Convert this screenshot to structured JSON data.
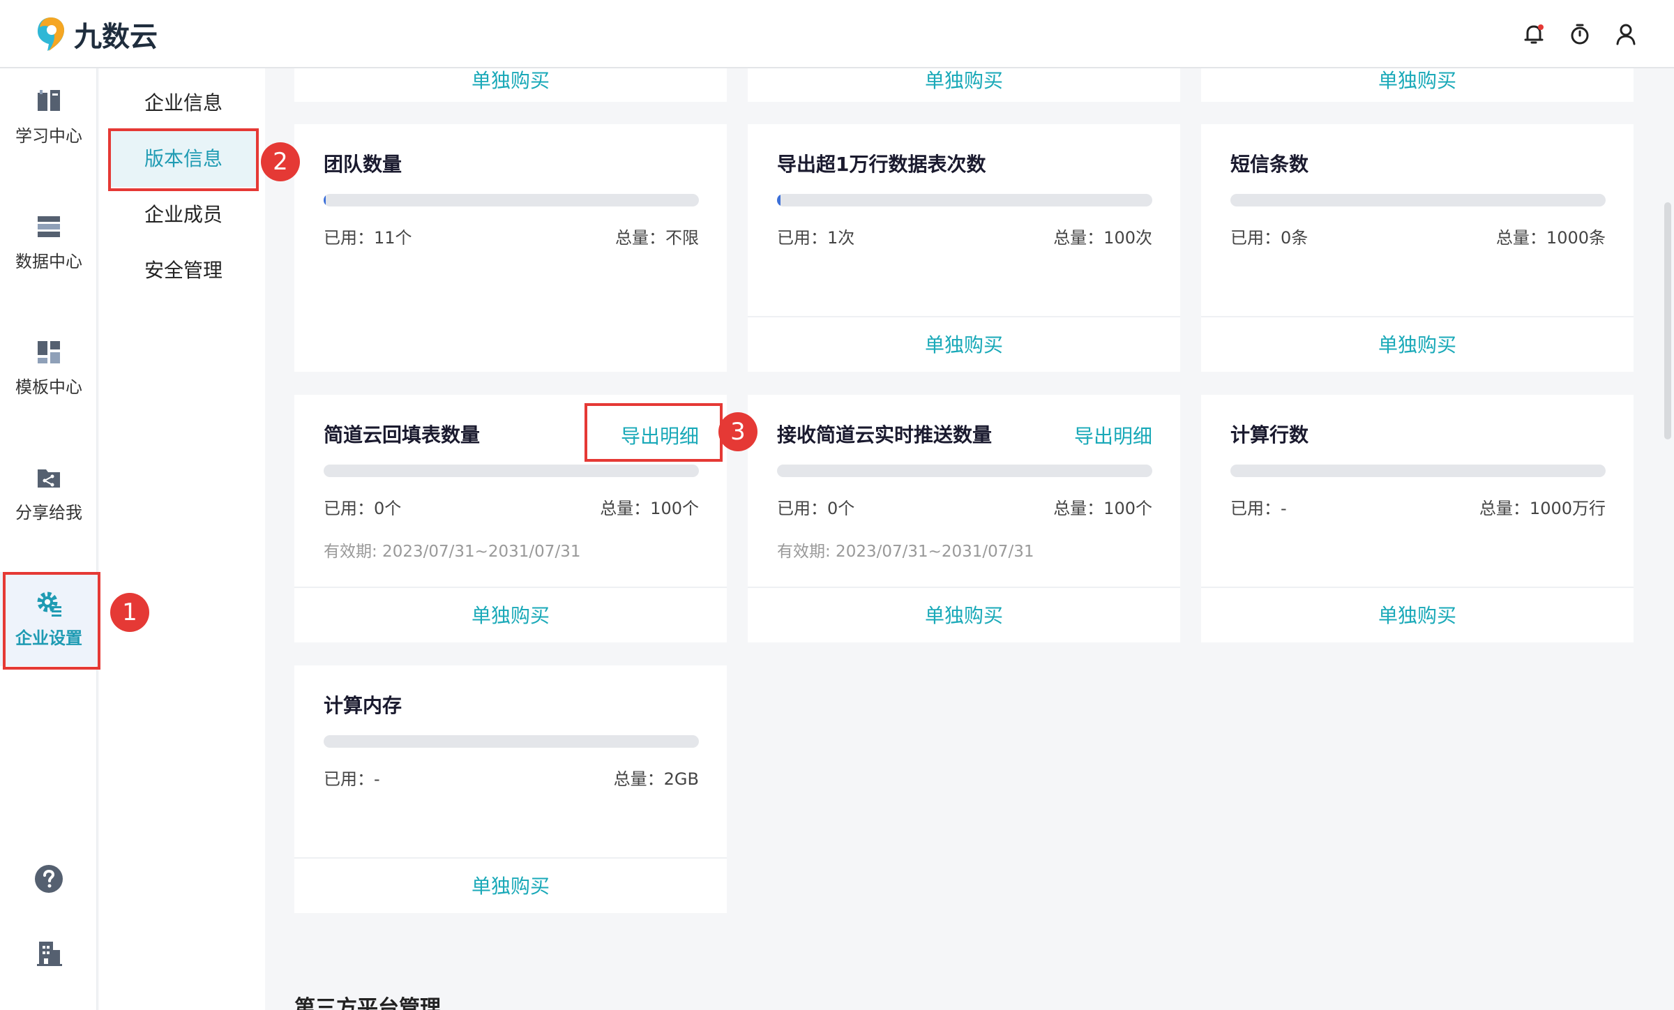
{
  "app": {
    "name": "九数云"
  },
  "colors": {
    "accent": "#1aa9b8",
    "progress": "#3b6fd8",
    "annotation": "#e53935"
  },
  "header": {
    "icons": [
      "bell-icon",
      "timer-icon",
      "user-icon"
    ]
  },
  "nav": {
    "items": [
      {
        "label": "学习中心",
        "icon": "book-icon"
      },
      {
        "label": "数据中心",
        "icon": "database-icon"
      },
      {
        "label": "模板中心",
        "icon": "template-icon"
      },
      {
        "label": "分享给我",
        "icon": "share-folder-icon"
      },
      {
        "label": "企业设置",
        "icon": "gear-icon",
        "active": true
      }
    ],
    "bottom_icons": [
      "help-icon",
      "building-icon"
    ]
  },
  "subnav": {
    "items": [
      {
        "label": "企业信息"
      },
      {
        "label": "版本信息",
        "active": true
      },
      {
        "label": "企业成员"
      },
      {
        "label": "安全管理"
      }
    ]
  },
  "cards": {
    "buy_label": "单独购买",
    "export_label": "导出明细",
    "team": {
      "title": "团队数量",
      "used": "已用：11个",
      "total": "总量：不限",
      "progress": 0.005
    },
    "export_rows": {
      "title": "导出超1万行数据表次数",
      "used": "已用：1次",
      "total": "总量：100次",
      "progress": 0.01
    },
    "sms": {
      "title": "短信条数",
      "used": "已用：0条",
      "total": "总量：1000条",
      "progress": 0
    },
    "fill_form": {
      "title": "简道云回填表数量",
      "used": "已用：0个",
      "total": "总量：100个",
      "validity": "有效期: 2023/07/31~2031/07/31",
      "progress": 0
    },
    "push": {
      "title": "接收简道云实时推送数量",
      "used": "已用：0个",
      "total": "总量：100个",
      "validity": "有效期: 2023/07/31~2031/07/31",
      "progress": 0
    },
    "calc_rows": {
      "title": "计算行数",
      "used": "已用：-",
      "total": "总量：1000万行",
      "progress": 0
    },
    "calc_memory": {
      "title": "计算内存",
      "used": "已用：-",
      "total": "总量：2GB",
      "progress": 0
    }
  },
  "section": {
    "title": "第三方平台管理"
  },
  "annotations": [
    "1",
    "2",
    "3"
  ]
}
